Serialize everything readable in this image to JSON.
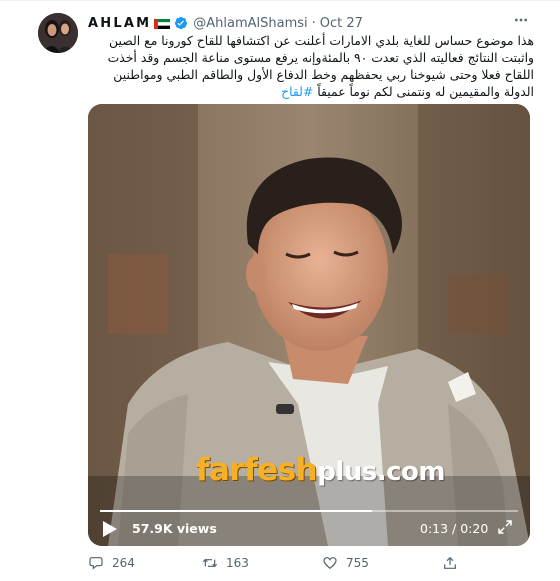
{
  "tweet": {
    "author_name": "AHLAM",
    "handle": "@AhlamAlShamsi",
    "separator": "·",
    "date": "Oct 27",
    "text_lines": [
      "هذا موضوع حساس للغاية بلدي الامارات أعلنت عن اكتشافها للقاح كورونا مع الصين",
      "واثبتت النتائج فعاليته الذي تعدت ٩٠ بالمئةوإنه يرفع مستوى مناعة الجسم وقد أخذت",
      "اللقاح فعلا وحتى شيوخنا ربي يحفظهم وخط الدفاع الأول والطاقم الطبي ومواطنين",
      "الدولة والمقيمين له ونتمنى لكم نوماً عميقاً"
    ],
    "hashtag": "#لقاح"
  },
  "media": {
    "watermark_part1": "farfesh",
    "watermark_part2": "plus.com",
    "views": "57.9K views",
    "time": "0:13 / 0:20",
    "progress_fraction": 0.65
  },
  "actions": {
    "replies": "264",
    "retweets": "163",
    "likes": "755"
  },
  "icons": {
    "verified": "verified-badge-icon",
    "flag": "uae-flag-icon",
    "more": "more-icon",
    "play": "play-icon",
    "expand": "expand-icon",
    "reply": "reply-icon",
    "retweet": "retweet-icon",
    "like": "like-icon",
    "share": "share-icon"
  },
  "colors": {
    "accent": "#1d9bf0",
    "secondary_text": "#536471",
    "watermark_orange": "#f6b024"
  }
}
